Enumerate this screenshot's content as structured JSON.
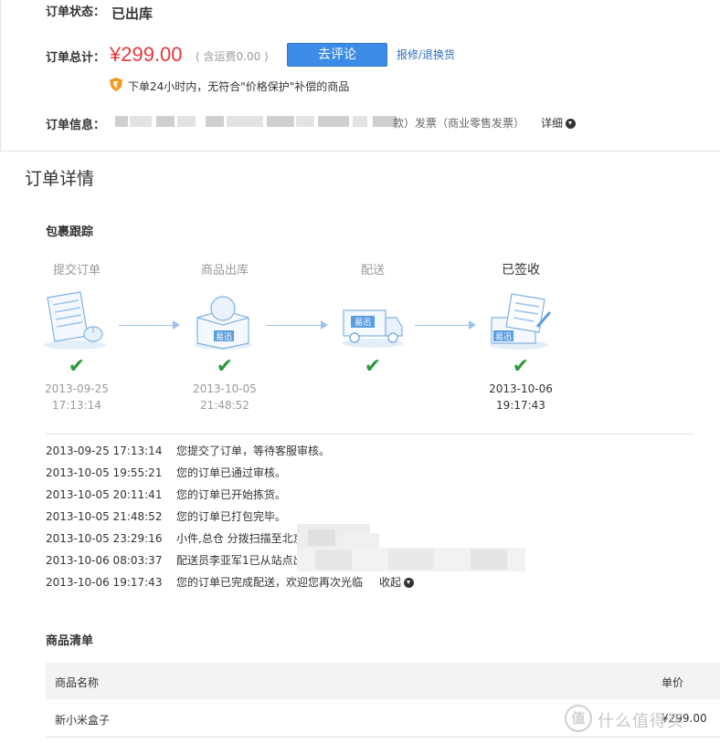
{
  "order": {
    "status_label": "订单状态：",
    "status_value": "已出库",
    "total_label": "订单总计：",
    "total_price": "¥299.00",
    "freight_note": "( 含运费0.00 )",
    "review_button": "去评论",
    "repair_link": "报修/退换货",
    "guarantee_note": "下单24小时内，无符合\"价格保护\"补偿的商品",
    "info_label": "订单信息：",
    "invoice_text": "款）发票（商业零售发票）",
    "detail_toggle": "详细"
  },
  "detail": {
    "section_title": "订单详情",
    "tracking_title": "包裹跟踪",
    "steps": [
      {
        "label": "提交订单",
        "icon": "order-form-icon",
        "date": "2013-09-25",
        "time": "17:13:14",
        "done": true
      },
      {
        "label": "商品出库",
        "icon": "package-box-icon",
        "date": "2013-10-05",
        "time": "21:48:52",
        "done": true
      },
      {
        "label": "配送",
        "icon": "delivery-truck-icon",
        "date": "",
        "time": "",
        "done": true
      },
      {
        "label": "已签收",
        "icon": "signed-receipt-icon",
        "date": "2013-10-06",
        "time": "19:17:43",
        "done": true
      }
    ],
    "log": [
      {
        "time": "2013-09-25 17:13:14",
        "text": "您提交了订单，等待客服审核。"
      },
      {
        "time": "2013-10-05 19:55:21",
        "text": "您的订单已通过审核。"
      },
      {
        "time": "2013-10-05 20:11:41",
        "text": "您的订单已开始拣货。"
      },
      {
        "time": "2013-10-05 21:48:52",
        "text": "您的订单已打包完毕。"
      },
      {
        "time": "2013-10-05 23:29:16",
        "text": "小件,总仓 分拨扫描至北京"
      },
      {
        "time": "2013-10-06 08:03:37",
        "text": "配送员李亚军1已从站点出"
      },
      {
        "time": "2013-10-06 19:17:43",
        "text": "您的订单已完成配送，欢迎您再次光临"
      }
    ],
    "collapse_toggle": "收起"
  },
  "products": {
    "title": "商品清单",
    "columns": [
      "商品名称",
      "单价"
    ],
    "rows": [
      {
        "name": "新小米盒子",
        "price": "¥299.00"
      }
    ]
  },
  "watermark": "值 什么值得买",
  "colors": {
    "price": "#e4393c",
    "button": "#3c8be6",
    "link": "#2c6fbf",
    "check": "#2e9a3d",
    "arrow": "#9cc2ea"
  }
}
